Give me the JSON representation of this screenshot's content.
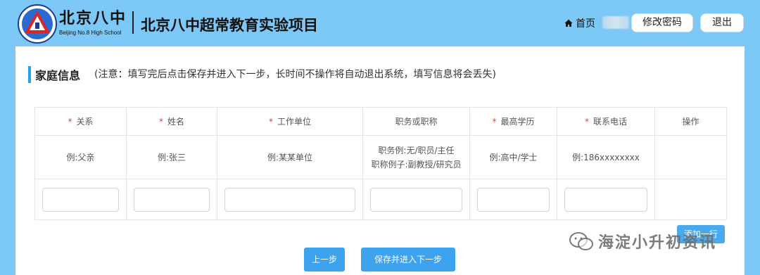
{
  "header": {
    "logo_cn": "北京八中",
    "logo_en": "Beijing No.8 High School",
    "title": "北京八中超常教育实验项目",
    "home_label": "首页",
    "change_password_label": "修改密码",
    "logout_label": "退出"
  },
  "section": {
    "title": "家庭信息",
    "note": "(注意：填写完后点击保存并进入下一步，长时间不操作将自动退出系统，填写信息将会丢失)"
  },
  "table": {
    "required_mark": "*",
    "headers": [
      "关系",
      "姓名",
      "工作单位",
      "职务或职称",
      "最高学历",
      "联系电话",
      "操作"
    ],
    "required": [
      true,
      true,
      true,
      false,
      true,
      true,
      false
    ],
    "examples": {
      "relation": "例:父亲",
      "name": "例:张三",
      "employer": "例:某某单位",
      "title_line1": "职务例:无/职员/主任",
      "title_line2": "职称例子:副教授/研究员",
      "education": "例:高中/学士",
      "phone": "例:186xxxxxxxx"
    }
  },
  "add_label": "添加一行",
  "nav": {
    "prev_label": "上一步",
    "next_label": "保存并进入下一步"
  },
  "watermark": "海淀小升初资讯",
  "colors": {
    "page_bg": "#7cc8f7",
    "accent": "#3ea3ee",
    "required": "#e23c3c"
  }
}
